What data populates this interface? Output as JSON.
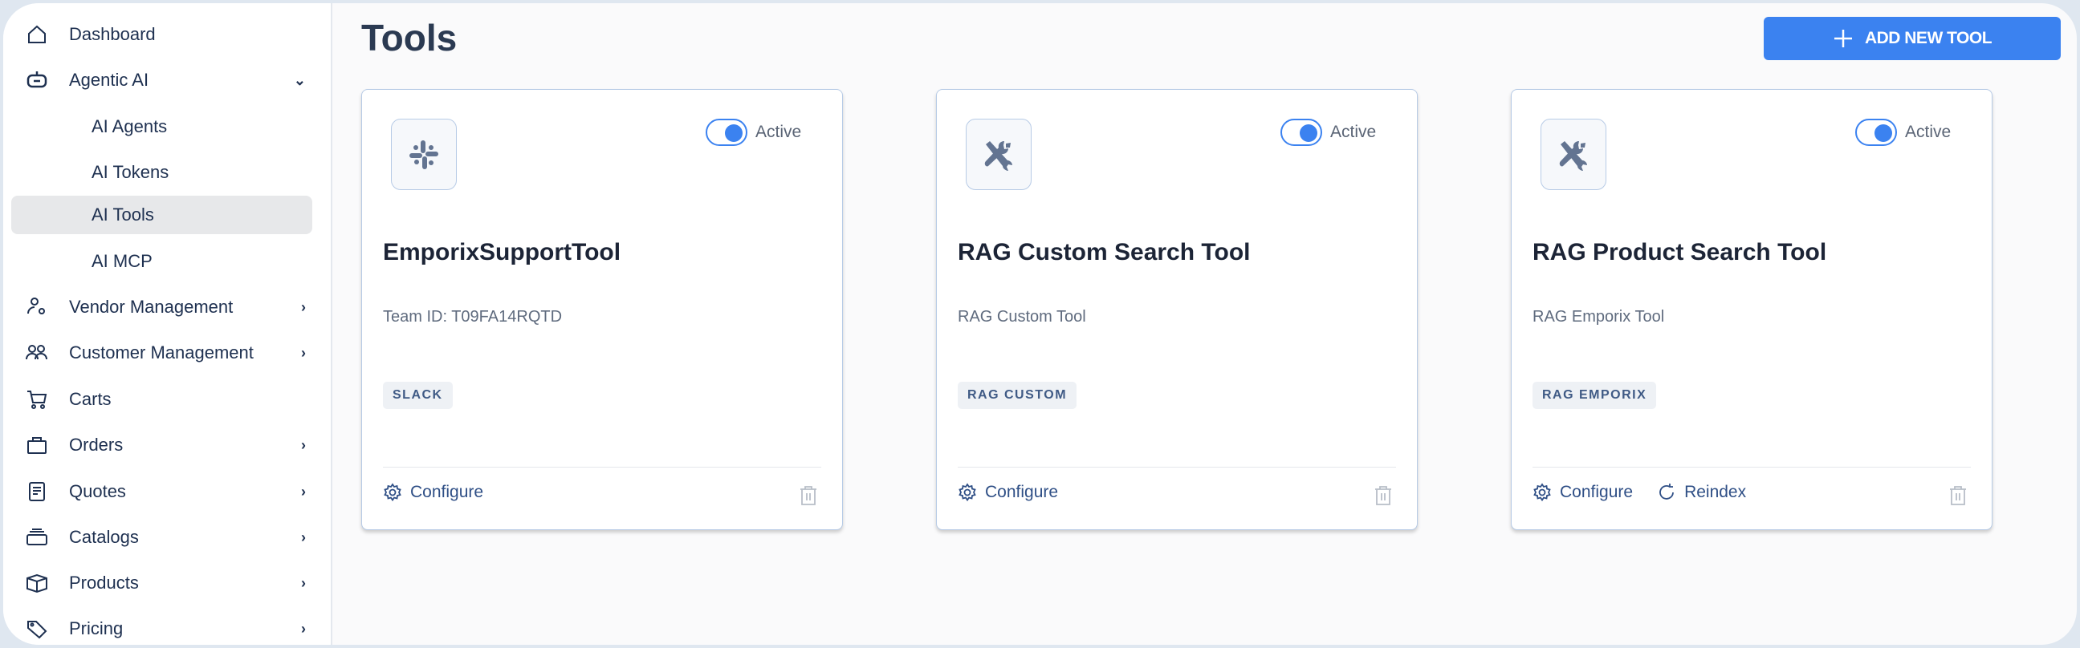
{
  "sidebar": {
    "items": [
      {
        "label": "Dashboard",
        "icon": "home-icon"
      },
      {
        "label": "Agentic AI",
        "icon": "robot-icon",
        "expanded": true
      },
      {
        "label": "AI Agents"
      },
      {
        "label": "AI Tokens"
      },
      {
        "label": "AI Tools",
        "selected": true
      },
      {
        "label": "AI MCP"
      },
      {
        "label": "Vendor Management",
        "icon": "vendor-icon"
      },
      {
        "label": "Customer Management",
        "icon": "customers-icon"
      },
      {
        "label": "Carts",
        "icon": "cart-icon"
      },
      {
        "label": "Orders",
        "icon": "bag-icon"
      },
      {
        "label": "Quotes",
        "icon": "document-icon"
      },
      {
        "label": "Catalogs",
        "icon": "catalog-icon"
      },
      {
        "label": "Products",
        "icon": "box-icon"
      },
      {
        "label": "Pricing",
        "icon": "tag-icon"
      }
    ]
  },
  "header": {
    "title": "Tools",
    "add_label": "ADD NEW TOOL"
  },
  "colors": {
    "accent": "#3b82f0",
    "text": "#1e3050"
  },
  "cards": [
    {
      "title": "EmporixSupportTool",
      "description": "Team ID: T09FA14RQTD",
      "tag": "SLACK",
      "status": "Active",
      "icon": "slack-icon",
      "configure": "Configure"
    },
    {
      "title": "RAG Custom Search Tool",
      "description": "RAG Custom Tool",
      "tag": "RAG CUSTOM",
      "status": "Active",
      "icon": "tools-icon",
      "configure": "Configure"
    },
    {
      "title": "RAG Product Search Tool",
      "description": "RAG Emporix Tool",
      "tag": "RAG EMPORIX",
      "status": "Active",
      "icon": "tools-icon",
      "configure": "Configure",
      "reindex": "Reindex"
    }
  ]
}
